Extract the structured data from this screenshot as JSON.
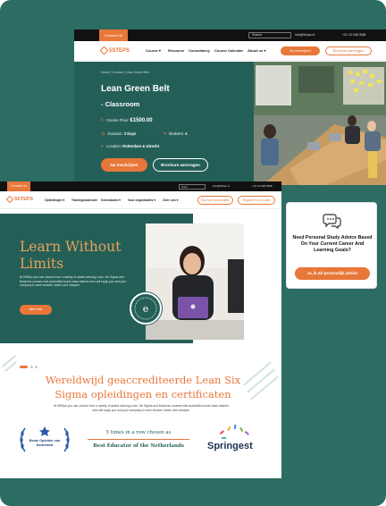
{
  "shot1": {
    "top_bar": {
      "contact": "Contact Us",
      "search_placeholder": "Search",
      "email": "info@5s3ps.nl",
      "phone": "+31 15 048 0068"
    },
    "logo": "5STEPS",
    "nav": [
      "Course ▾",
      "Resource",
      "Consultancy",
      "Course Calendar",
      "About us ▾"
    ],
    "buttons": {
      "enroll": "Nu inschrijven",
      "brochure": "Brochure aanvragen"
    },
    "breadcrumb": "Home  |  Courses  |  Lean Green Belt",
    "title": "Lean Green Belt",
    "subtitle": "- Classroom",
    "price_label": "Course Price:",
    "price": "€1500.00",
    "duration_label": "Duration:",
    "duration": "3 Days",
    "modules_label": "Modules:",
    "modules": "4",
    "location_label": "Location:",
    "location": "Rotterdam & Utrecht",
    "cta_enroll": "Nu Inschrijven",
    "cta_brochure": "Brochure aanvragen"
  },
  "shot2": {
    "top_bar": {
      "contact": "Contact Us",
      "search_placeholder": "Zoek",
      "email": "info@5s3ps.nl",
      "phone": "+31 15 048 0068"
    },
    "logo": "5STEPS",
    "nav": [
      "Opleidingen ▾",
      "Trainingskalender",
      "Kennisbank ▾",
      "Voor organisaties ▾",
      "Over ons ▾"
    ],
    "buttons": {
      "brochure": "Brochure downloaden",
      "register": "Register for a course"
    },
    "headline": "Learn Without Limits",
    "intro": "At 5StEps you can choose from a variety of award-winning Lean, Six Sigma and Business courses and accredited world-class trainers who will equip you and your company to work smarter, faster, and cheaper.",
    "more_button": "Meer Info",
    "section_title": "Wereldwijd geaccrediteerde Lean Six Sigma opleidingen en certificaten",
    "section_text": "At 5StEps you can choose from a variety of award-winning Lean, Six Sigma and Business courses with accredited world-class trainers who will equip you and your company to work smarter, faster, and cheaper.",
    "award_left": "Beste Opleider van Nederland",
    "award_mid_top": "5 times in a row chosen as",
    "award_mid_bottom": "Best Educator of the Netherlands",
    "award_right": "Springest"
  },
  "card": {
    "question": "Need Personal Study Advice Based On Your Current Career And Learning Goals?",
    "button": "Ja, ik wil persoonlijk advies"
  },
  "colors": {
    "teal": "#245f57",
    "orange": "#e8773a",
    "background": "#2c6c63"
  }
}
